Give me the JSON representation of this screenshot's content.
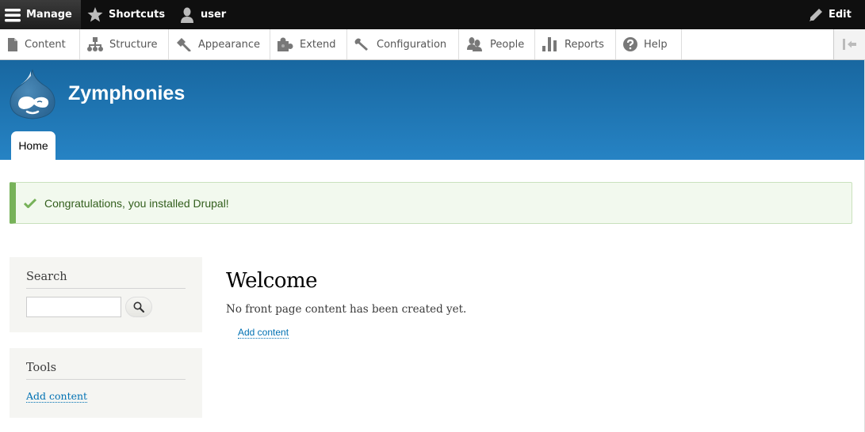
{
  "toolbar": {
    "manage_label": "Manage",
    "shortcuts_label": "Shortcuts",
    "user_label": "user",
    "edit_label": "Edit",
    "icons": {
      "manage": "hamburger-icon",
      "shortcuts": "star-icon",
      "user": "person-icon",
      "edit": "pencil-icon"
    }
  },
  "tray": {
    "items": [
      {
        "label": "Content",
        "icon": "file-icon"
      },
      {
        "label": "Structure",
        "icon": "sitemap-icon"
      },
      {
        "label": "Appearance",
        "icon": "paintbrush-icon"
      },
      {
        "label": "Extend",
        "icon": "puzzle-icon"
      },
      {
        "label": "Configuration",
        "icon": "wrench-icon"
      },
      {
        "label": "People",
        "icon": "people-icon"
      },
      {
        "label": "Reports",
        "icon": "bar-chart-icon"
      },
      {
        "label": "Help",
        "icon": "question-icon"
      }
    ],
    "orientation_toggle_icon": "collapse-left-icon"
  },
  "header": {
    "site_name": "Zymphonies",
    "tabs": [
      {
        "label": "Home",
        "active": true
      }
    ]
  },
  "message": {
    "text": "Congratulations, you installed Drupal!",
    "type": "status",
    "accent_color": "#77b259"
  },
  "sidebar": {
    "search": {
      "title": "Search",
      "input_value": "",
      "button_icon": "search-icon"
    },
    "tools": {
      "title": "Tools",
      "link": "Add content"
    }
  },
  "main": {
    "title": "Welcome",
    "body": "No front page content has been created yet.",
    "link": "Add content"
  },
  "colors": {
    "toolbar_bg": "#0f0f0f",
    "header_top": "#1867a0",
    "header_bottom": "#2683c4",
    "link": "#0071b3"
  }
}
